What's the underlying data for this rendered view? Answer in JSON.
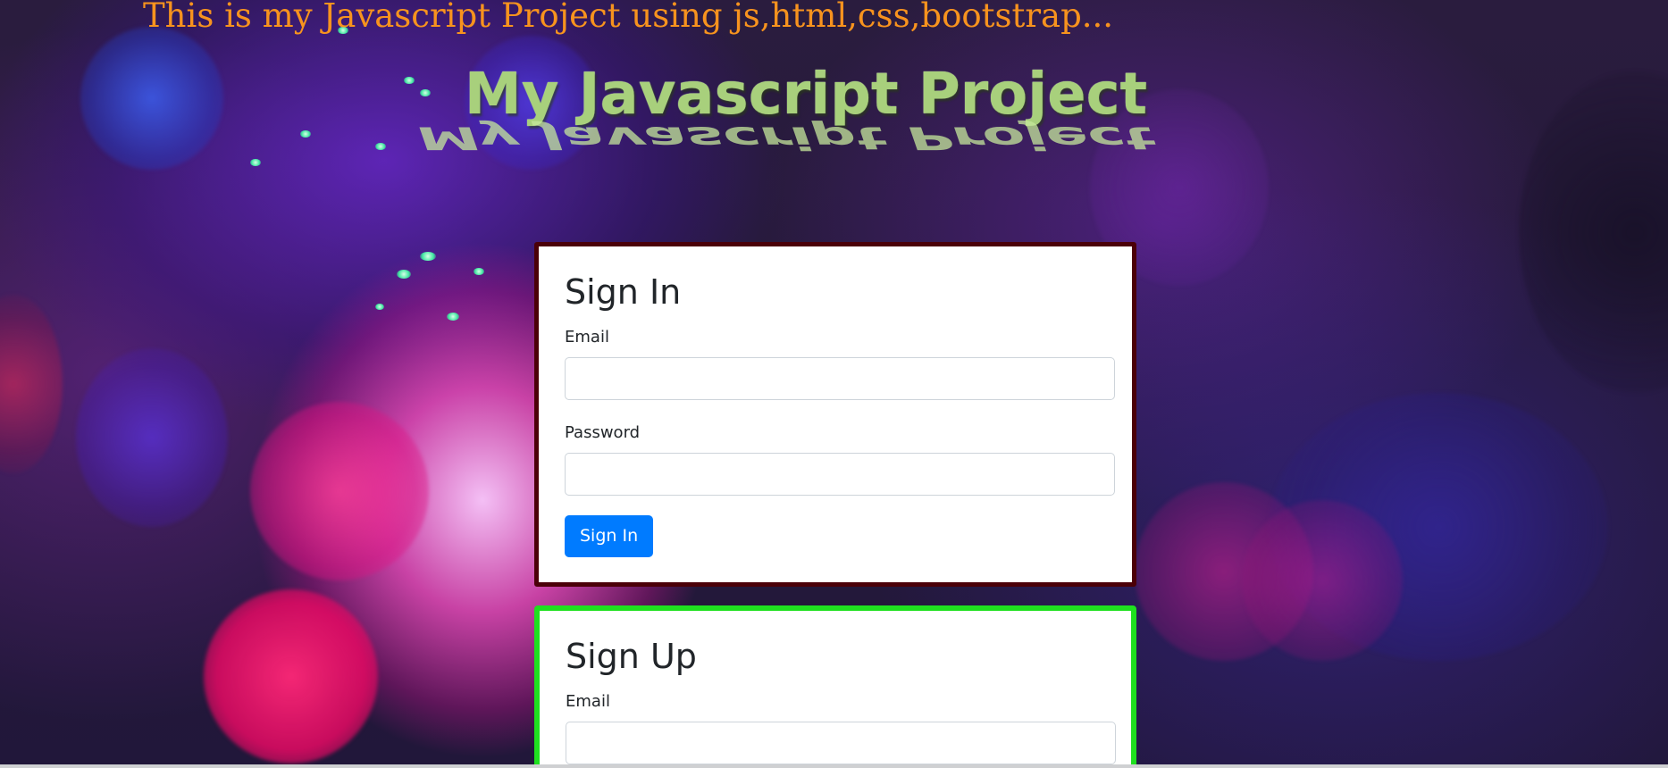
{
  "page": {
    "top_text": "This is my Javascript Project using js,html,css,bootstrap...",
    "hero_title": "My Javascript Project"
  },
  "sign_in": {
    "title": "Sign In",
    "email_label": "Email",
    "email_value": "",
    "password_label": "Password",
    "password_value": "",
    "submit_label": "Sign In"
  },
  "sign_up": {
    "title": "Sign Up",
    "email_label": "Email",
    "email_value": ""
  },
  "colors": {
    "top_text": "#f7931e",
    "hero_title": "#a8d07c",
    "sign_in_border": "#4b0008",
    "sign_up_border": "#1fe01f",
    "primary_button": "#007bff"
  }
}
